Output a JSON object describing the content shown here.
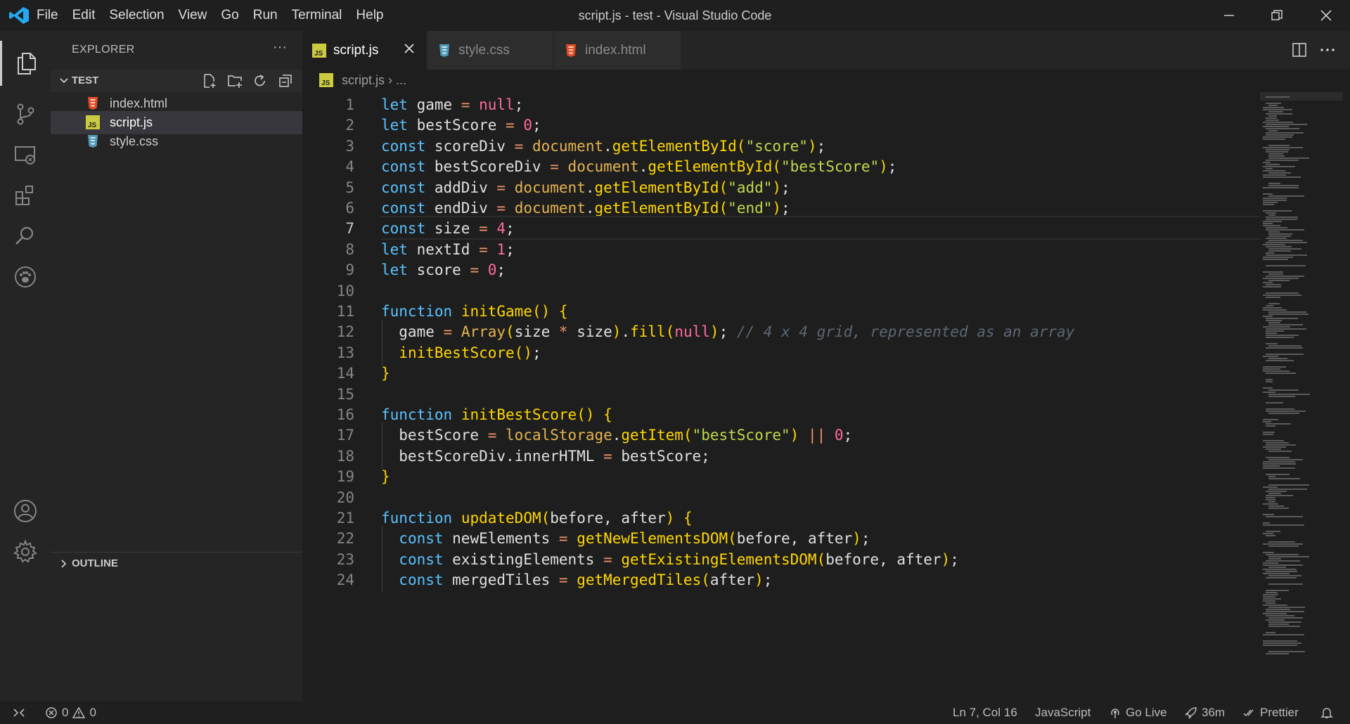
{
  "window": {
    "title": "script.js - test - Visual Studio Code",
    "menu": [
      "File",
      "Edit",
      "Selection",
      "View",
      "Go",
      "Run",
      "Terminal",
      "Help"
    ]
  },
  "activity_bar": {
    "items": [
      "files-icon",
      "source-control-icon",
      "remote-explorer-icon",
      "extensions-icon",
      "search-icon",
      "paw-icon"
    ],
    "bottom": [
      "account-icon",
      "settings-gear-icon"
    ]
  },
  "explorer": {
    "title": "EXPLORER",
    "more": "···",
    "folder": "TEST",
    "files": [
      {
        "name": "index.html",
        "icon": "html-icon",
        "color": "#e44d26"
      },
      {
        "name": "script.js",
        "icon": "js-icon",
        "color": "#cbcb41"
      },
      {
        "name": "style.css",
        "icon": "css-icon",
        "color": "#519aba"
      }
    ],
    "outline": "OUTLINE"
  },
  "tabs": [
    {
      "label": "script.js",
      "icon": "js-icon",
      "active": true
    },
    {
      "label": "style.css",
      "icon": "css-icon",
      "active": false
    },
    {
      "label": "index.html",
      "icon": "html-icon",
      "active": false
    }
  ],
  "breadcrumb": {
    "file": "script.js",
    "rest": "..."
  },
  "editor": {
    "current_line": 7,
    "lines": [
      "let game = null;",
      "let bestScore = 0;",
      "const scoreDiv = document.getElementById(\"score\");",
      "const bestScoreDiv = document.getElementById(\"bestScore\");",
      "const addDiv = document.getElementById(\"add\");",
      "const endDiv = document.getElementById(\"end\");",
      "const size = 4;",
      "let nextId = 1;",
      "let score = 0;",
      "",
      "function initGame() {",
      "  game = Array(size * size).fill(null); // 4 x 4 grid, represented as an array",
      "  initBestScore();",
      "}",
      "",
      "function initBestScore() {",
      "  bestScore = localStorage.getItem(\"bestScore\") || 0;",
      "  bestScoreDiv.innerHTML = bestScore;",
      "}",
      "",
      "function updateDOM(before, after) {",
      "  const newElements = getNewElementsDOM(before, after);",
      "  const existingElements = getExistingElementsDOM(before, after);",
      "  const mergedTiles = getMergedTiles(after);"
    ]
  },
  "status": {
    "errors": "0",
    "warnings": "0",
    "position": "Ln 7, Col 16",
    "language": "JavaScript",
    "golive": "Go Live",
    "time": "36m",
    "prettier": "Prettier"
  },
  "colors": {
    "keyword": "#59c2ff",
    "function": "#ffd700",
    "string": "#c2d94c",
    "number": "#ff6b9e",
    "comment": "#5c6773",
    "vscode_blue": "#23a9f2"
  }
}
